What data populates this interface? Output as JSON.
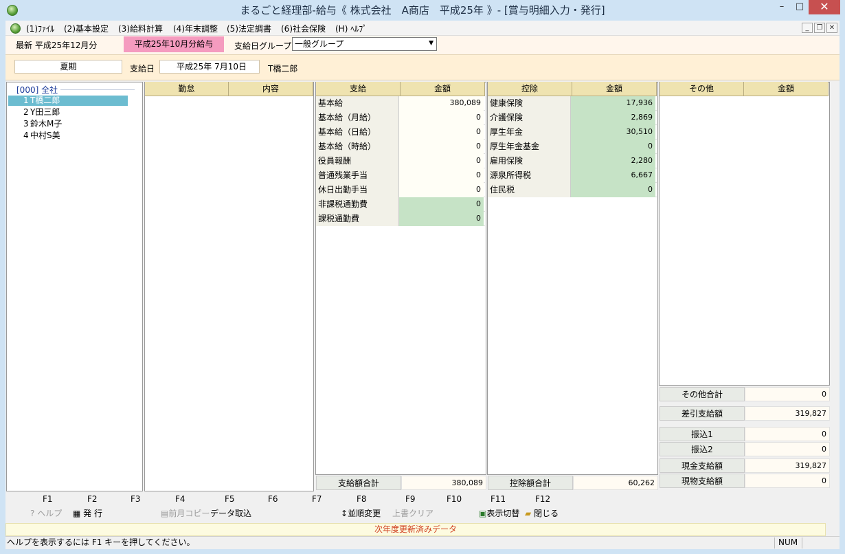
{
  "window": {
    "title": "まるごと経理部-給与《 株式会社　A商店　平成25年 》- [賞与明細入力・発行]",
    "min": "–",
    "max": "□",
    "close": "✕",
    "mdi_min": "_",
    "mdi_restore": "❐",
    "mdi_close": "✕"
  },
  "menu": [
    "(1)ﾌｧｲﾙ",
    "(2)基本設定",
    "(3)給料計算",
    "(4)年末調整",
    "(5)法定調書",
    "(6)社会保険",
    "(H) ﾍﾙﾌﾟ"
  ],
  "toprow": {
    "latest": "最新 平成25年12月分",
    "selected_payroll": "平成25年10月分給与",
    "group_label": "支給日グループ",
    "group_value": "一般グループ"
  },
  "info": {
    "period": "夏期",
    "payday_label": "支給日",
    "payday_value": "平成25年 7月10日",
    "employee_name": "T橋二郎"
  },
  "employees": {
    "root": "[000] 全社",
    "items": [
      {
        "no": "1",
        "name": "T橋二郎"
      },
      {
        "no": "2",
        "name": "Y田三郎"
      },
      {
        "no": "3",
        "name": "鈴木M子"
      },
      {
        "no": "4",
        "name": "中村S美"
      }
    ]
  },
  "attendance": {
    "col1": "勤怠",
    "col2": "内容"
  },
  "payments": {
    "col1": "支給",
    "col2": "金額",
    "rows": [
      {
        "label": "基本給",
        "value": "380,089",
        "green": false
      },
      {
        "label": "基本給（月給）",
        "value": "0",
        "green": false
      },
      {
        "label": "基本給（日給）",
        "value": "0",
        "green": false
      },
      {
        "label": "基本給（時給）",
        "value": "0",
        "green": false
      },
      {
        "label": "役員報酬",
        "value": "0",
        "green": false
      },
      {
        "label": "普通残業手当",
        "value": "0",
        "green": false
      },
      {
        "label": "休日出勤手当",
        "value": "0",
        "green": false
      },
      {
        "label": "非課税通勤費",
        "value": "0",
        "green": true
      },
      {
        "label": "課税通勤費",
        "value": "0",
        "green": true
      }
    ],
    "total_label": "支給額合計",
    "total_value": "380,089"
  },
  "deductions": {
    "col1": "控除",
    "col2": "金額",
    "rows": [
      {
        "label": "健康保険",
        "value": "17,936"
      },
      {
        "label": "介護保険",
        "value": "2,869"
      },
      {
        "label": "厚生年金",
        "value": "30,510"
      },
      {
        "label": "厚生年金基金",
        "value": "0"
      },
      {
        "label": "雇用保険",
        "value": "2,280"
      },
      {
        "label": "源泉所得税",
        "value": "6,667"
      },
      {
        "label": "住民税",
        "value": "0"
      }
    ],
    "total_label": "控除額合計",
    "total_value": "60,262"
  },
  "other": {
    "col1": "その他",
    "col2": "金額",
    "sums": [
      {
        "label": "その他合計",
        "value": "0"
      },
      {
        "label": "差引支給額",
        "value": "319,827"
      },
      {
        "label": "振込1",
        "value": "0"
      },
      {
        "label": "振込2",
        "value": "0"
      },
      {
        "label": "現金支給額",
        "value": "319,827"
      },
      {
        "label": "現物支給額",
        "value": "0"
      }
    ]
  },
  "fkeys": [
    "F1",
    "F2",
    "F3",
    "F4",
    "F5",
    "F6",
    "F7",
    "F8",
    "F9",
    "F10",
    "F11",
    "F12"
  ],
  "factions": {
    "help": "ヘルプ",
    "issue": "発 行",
    "prev_copy": "前月コピー",
    "import": "データ取込",
    "sort": "並順変更",
    "overwrite_clear": "上書クリア",
    "display_toggle": "表示切替",
    "close": "閉じる"
  },
  "notice": "次年度更新済みデータ",
  "status": {
    "help_text": "ヘルプを表示するには F1 キーを押してください。",
    "num": "NUM"
  },
  "colors": {
    "accent_pink": "#f59bbf",
    "header_beige": "#efe3b0",
    "green_cell": "#c6e3c6",
    "selected_employee": "#6cbcd0",
    "notice_red": "#d04020"
  }
}
